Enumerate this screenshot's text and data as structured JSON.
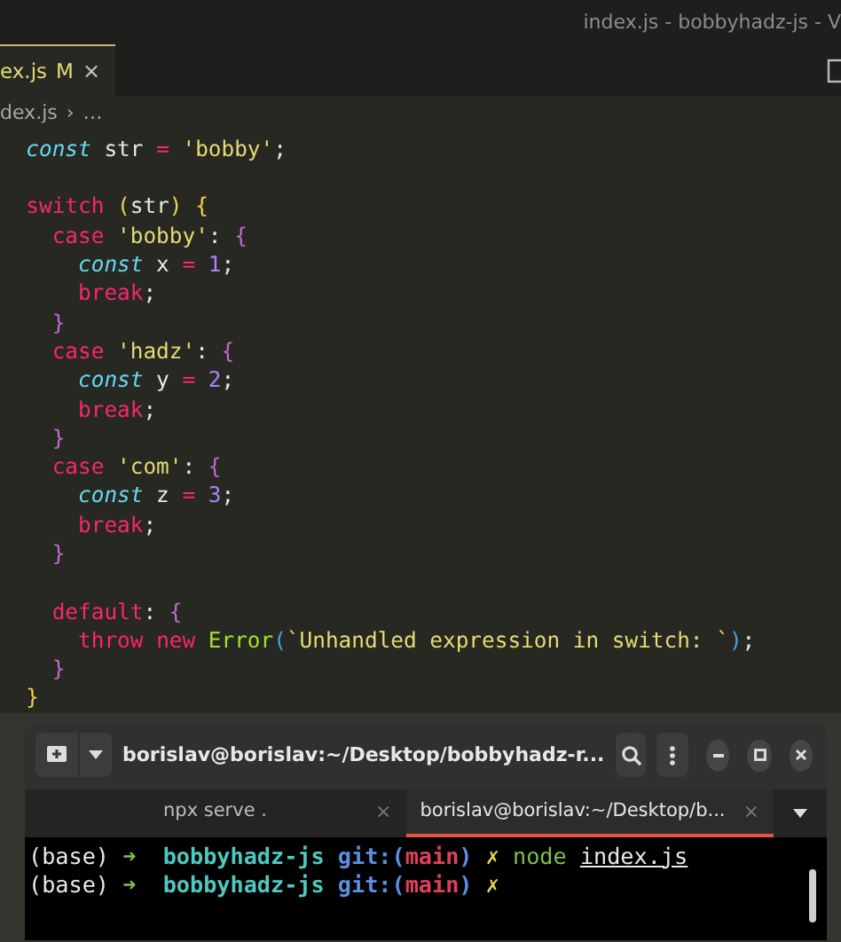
{
  "window": {
    "title": "index.js - bobbyhadz-js - V"
  },
  "tabs": [
    {
      "label": "ex.js",
      "badge": "M",
      "close": "×",
      "selected": true
    }
  ],
  "breadcrumb": {
    "file": "dex.js",
    "separator": "›",
    "rest": "…"
  },
  "code_lines": [
    {
      "kind": "code",
      "tokens": [
        {
          "kind": "storage",
          "text": "  const"
        },
        {
          "kind": "plain",
          "text": " str "
        },
        {
          "kind": "operator",
          "text": "="
        },
        {
          "kind": "string",
          "text": " 'bobby'"
        },
        {
          "kind": "plain",
          "text": ";"
        }
      ]
    },
    {
      "kind": "blank"
    },
    {
      "kind": "code",
      "tokens": [
        {
          "kind": "keyword",
          "text": "  switch "
        },
        {
          "kind": "bracket",
          "text": "("
        },
        {
          "kind": "plain",
          "text": "str"
        },
        {
          "kind": "bracket",
          "text": ") {"
        }
      ]
    },
    {
      "kind": "code",
      "tokens": [
        {
          "kind": "keyword",
          "text": "    case "
        },
        {
          "kind": "string",
          "text": "'bobby'"
        },
        {
          "kind": "plain",
          "text": ": "
        },
        {
          "kind": "bracket2",
          "text": "{"
        }
      ]
    },
    {
      "kind": "code",
      "tokens": [
        {
          "kind": "storage",
          "text": "      const"
        },
        {
          "kind": "plain",
          "text": " x "
        },
        {
          "kind": "operator",
          "text": "="
        },
        {
          "kind": "number",
          "text": " 1"
        },
        {
          "kind": "plain",
          "text": ";"
        }
      ]
    },
    {
      "kind": "code",
      "tokens": [
        {
          "kind": "keyword",
          "text": "      break"
        },
        {
          "kind": "plain",
          "text": ";"
        }
      ]
    },
    {
      "kind": "code",
      "tokens": [
        {
          "kind": "bracket2",
          "text": "    }"
        }
      ]
    },
    {
      "kind": "code",
      "tokens": [
        {
          "kind": "keyword",
          "text": "    case "
        },
        {
          "kind": "string",
          "text": "'hadz'"
        },
        {
          "kind": "plain",
          "text": ": "
        },
        {
          "kind": "bracket2",
          "text": "{"
        }
      ]
    },
    {
      "kind": "code",
      "tokens": [
        {
          "kind": "storage",
          "text": "      const"
        },
        {
          "kind": "plain",
          "text": " y "
        },
        {
          "kind": "operator",
          "text": "="
        },
        {
          "kind": "number",
          "text": " 2"
        },
        {
          "kind": "plain",
          "text": ";"
        }
      ]
    },
    {
      "kind": "code",
      "tokens": [
        {
          "kind": "keyword",
          "text": "      break"
        },
        {
          "kind": "plain",
          "text": ";"
        }
      ]
    },
    {
      "kind": "code",
      "tokens": [
        {
          "kind": "bracket2",
          "text": "    }"
        }
      ]
    },
    {
      "kind": "code",
      "tokens": [
        {
          "kind": "keyword",
          "text": "    case "
        },
        {
          "kind": "string",
          "text": "'com'"
        },
        {
          "kind": "plain",
          "text": ": "
        },
        {
          "kind": "bracket2",
          "text": "{"
        }
      ]
    },
    {
      "kind": "code",
      "tokens": [
        {
          "kind": "storage",
          "text": "      const"
        },
        {
          "kind": "plain",
          "text": " z "
        },
        {
          "kind": "operator",
          "text": "="
        },
        {
          "kind": "number",
          "text": " 3"
        },
        {
          "kind": "plain",
          "text": ";"
        }
      ]
    },
    {
      "kind": "code",
      "tokens": [
        {
          "kind": "keyword",
          "text": "      break"
        },
        {
          "kind": "plain",
          "text": ";"
        }
      ]
    },
    {
      "kind": "code",
      "tokens": [
        {
          "kind": "bracket2",
          "text": "    }"
        }
      ]
    },
    {
      "kind": "blank"
    },
    {
      "kind": "code",
      "tokens": [
        {
          "kind": "keyword",
          "text": "    default"
        },
        {
          "kind": "plain",
          "text": ": "
        },
        {
          "kind": "bracket2",
          "text": "{"
        }
      ]
    },
    {
      "kind": "code",
      "tokens": [
        {
          "kind": "keyword",
          "text": "      throw "
        },
        {
          "kind": "keyword",
          "text": "new "
        },
        {
          "kind": "function",
          "text": "Error"
        },
        {
          "kind": "bracket3",
          "text": "("
        },
        {
          "kind": "string",
          "text": "`Unhandled expression in switch: `"
        },
        {
          "kind": "bracket3",
          "text": ")"
        },
        {
          "kind": "plain",
          "text": ";"
        }
      ]
    },
    {
      "kind": "code",
      "tokens": [
        {
          "kind": "bracket2",
          "text": "    }"
        }
      ]
    },
    {
      "kind": "code",
      "tokens": [
        {
          "kind": "bracket",
          "text": "  }"
        }
      ]
    }
  ],
  "terminal": {
    "title": "borislav@borislav:~/Desktop/bobbyhadz-r...",
    "tabs": [
      {
        "label": "npx serve .",
        "close": "×",
        "selected": false
      },
      {
        "label": "borislav@borislav:~/Desktop/b...",
        "close": "×",
        "selected": true
      }
    ],
    "lines": [
      {
        "tokens": [
          {
            "kind": "plain",
            "text": "(base) "
          },
          {
            "kind": "arrow",
            "text": "➜  "
          },
          {
            "kind": "dir",
            "text": "bobbyhadz-js "
          },
          {
            "kind": "git",
            "text": "git:("
          },
          {
            "kind": "branch",
            "text": "main"
          },
          {
            "kind": "git",
            "text": ") "
          },
          {
            "kind": "dirty",
            "text": "✗ "
          },
          {
            "kind": "command",
            "text": "node "
          },
          {
            "kind": "path",
            "text": "index.js"
          }
        ]
      },
      {
        "tokens": [
          {
            "kind": "plain",
            "text": "(base) "
          },
          {
            "kind": "arrow",
            "text": "➜  "
          },
          {
            "kind": "dir",
            "text": "bobbyhadz-js "
          },
          {
            "kind": "git",
            "text": "git:("
          },
          {
            "kind": "branch",
            "text": "main"
          },
          {
            "kind": "git",
            "text": ") "
          },
          {
            "kind": "dirty",
            "text": "✗"
          }
        ]
      }
    ]
  }
}
